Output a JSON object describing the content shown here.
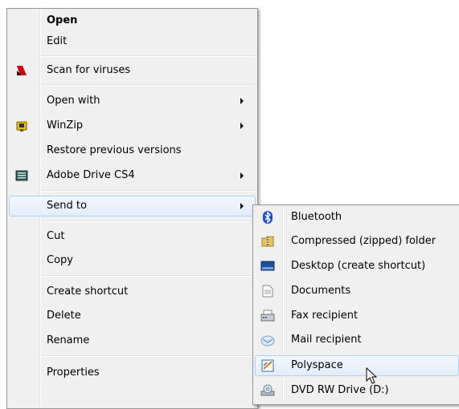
{
  "main_menu": {
    "items": [
      {
        "label": "Open",
        "icon": "",
        "bold": true
      },
      {
        "label": "Edit",
        "icon": ""
      },
      {
        "label": "Scan for viruses",
        "icon": "kaspersky-icon"
      },
      {
        "label": "Open with",
        "icon": "",
        "submenu": true
      },
      {
        "label": "WinZip",
        "icon": "winzip-icon",
        "submenu": true
      },
      {
        "label": "Restore previous versions",
        "icon": ""
      },
      {
        "label": "Adobe Drive CS4",
        "icon": "adobe-drive-icon",
        "submenu": true
      },
      {
        "label": "Send to",
        "icon": "",
        "submenu": true,
        "highlighted": true
      },
      {
        "label": "Cut",
        "icon": ""
      },
      {
        "label": "Copy",
        "icon": ""
      },
      {
        "label": "Create shortcut",
        "icon": ""
      },
      {
        "label": "Delete",
        "icon": ""
      },
      {
        "label": "Rename",
        "icon": ""
      },
      {
        "label": "Properties",
        "icon": ""
      }
    ]
  },
  "sendto_menu": {
    "items": [
      {
        "label": "Bluetooth",
        "icon": "bluetooth-icon"
      },
      {
        "label": "Compressed (zipped) folder",
        "icon": "zip-folder-icon"
      },
      {
        "label": "Desktop (create shortcut)",
        "icon": "desktop-icon"
      },
      {
        "label": "Documents",
        "icon": "documents-icon"
      },
      {
        "label": "Fax recipient",
        "icon": "fax-icon"
      },
      {
        "label": "Mail recipient",
        "icon": "mail-icon"
      },
      {
        "label": "Polyspace",
        "icon": "polyspace-icon",
        "highlighted": true
      },
      {
        "label": "DVD RW Drive (D:)",
        "icon": "dvd-drive-icon"
      }
    ]
  },
  "colors": {
    "menu_bg": "#f0f0f0",
    "menu_border": "#979797",
    "highlight_border": "#aecff7",
    "kaspersky_red": "#d4000f",
    "bluetooth_blue": "#1f4fd6"
  }
}
